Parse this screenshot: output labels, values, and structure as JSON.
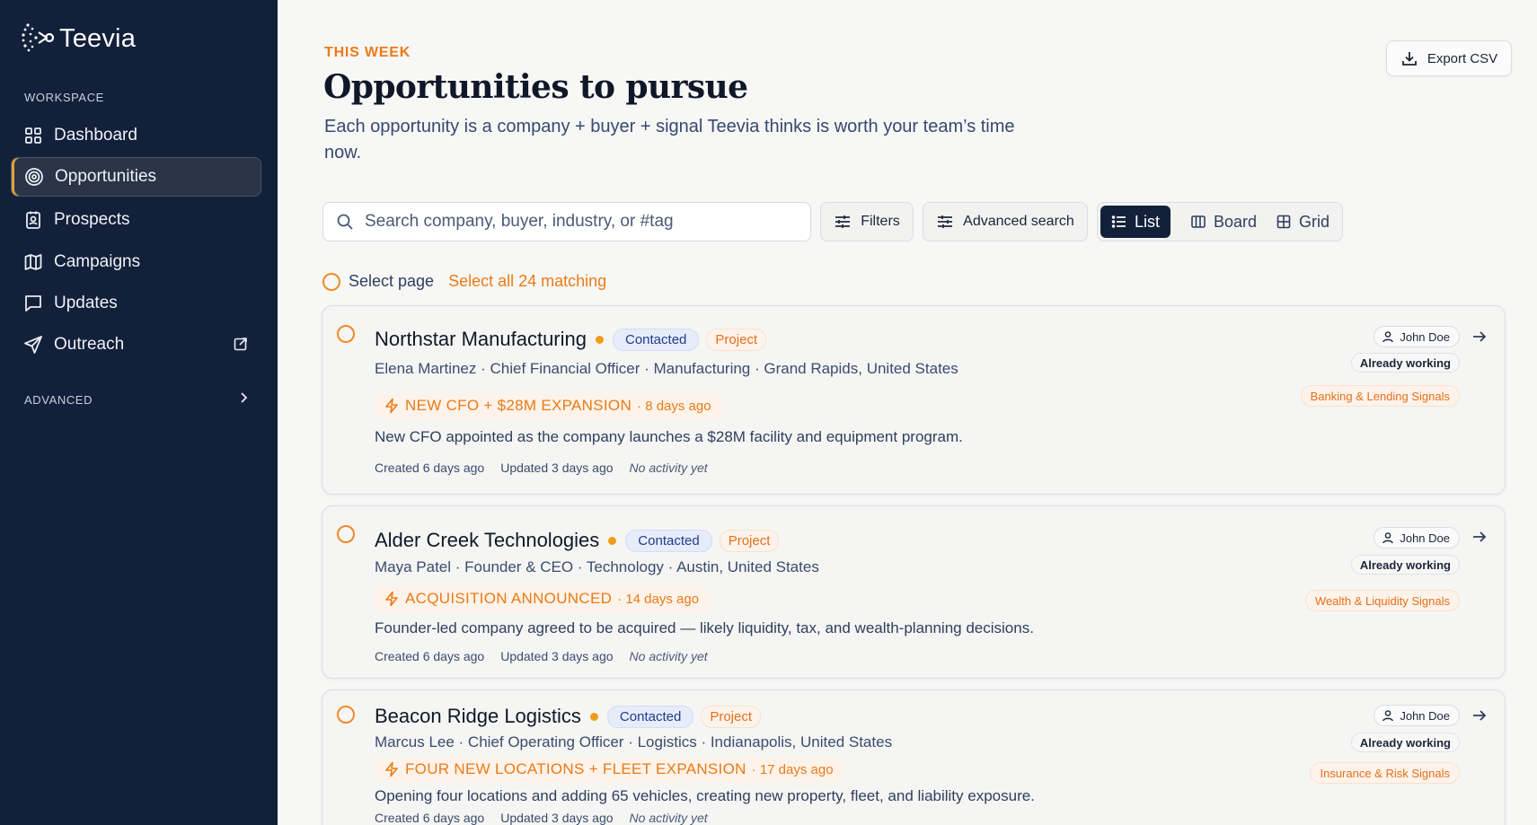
{
  "sidebar": {
    "brand": "Teevia",
    "workspace_label": "WORKSPACE",
    "items": [
      {
        "label": "Dashboard"
      },
      {
        "label": "Opportunities"
      },
      {
        "label": "Prospects"
      },
      {
        "label": "Campaigns"
      },
      {
        "label": "Updates"
      },
      {
        "label": "Outreach"
      }
    ],
    "advanced_label": "ADVANCED"
  },
  "header": {
    "eyebrow": "THIS WEEK",
    "title": "Opportunities to pursue",
    "subtitle": "Each opportunity is a company + buyer + signal Teevia thinks is worth your team’s time now.",
    "export_label": "Export CSV"
  },
  "toolbar": {
    "search_placeholder": "Search company, buyer, industry, or #tag",
    "filters_label": "Filters",
    "advanced_label": "Advanced search",
    "views": [
      "List",
      "Board",
      "Grid"
    ],
    "active_view": "List"
  },
  "selection": {
    "select_page": "Select page",
    "select_all": "Select all 24 matching"
  },
  "opportunities": [
    {
      "company": "Northstar Manufacturing",
      "status": "Contacted",
      "type": "Project",
      "meta": "Elena Martinez · Chief Financial Officer · Manufacturing · Grand Rapids, United States",
      "signal": "NEW CFO + $28M EXPANSION",
      "signal_age": "· 8 days ago",
      "description": "New CFO appointed as the company launches a $28M facility and equipment program.",
      "created": "Created 6 days ago",
      "updated": "Updated 3 days ago",
      "activity": "No activity yet",
      "owner": "John Doe",
      "working": "Already working",
      "tag": "Banking & Lending Signals"
    },
    {
      "company": "Alder Creek Technologies",
      "status": "Contacted",
      "type": "Project",
      "meta": "Maya Patel · Founder & CEO · Technology · Austin, United States",
      "signal": "ACQUISITION ANNOUNCED",
      "signal_age": "· 14 days ago",
      "description": "Founder-led company agreed to be acquired — likely liquidity, tax, and wealth-planning decisions.",
      "created": "Created 6 days ago",
      "updated": "Updated 3 days ago",
      "activity": "No activity yet",
      "owner": "John Doe",
      "working": "Already working",
      "tag": "Wealth & Liquidity Signals"
    },
    {
      "company": "Beacon Ridge Logistics",
      "status": "Contacted",
      "type": "Project",
      "meta": "Marcus Lee · Chief Operating Officer · Logistics · Indianapolis, United States",
      "signal": "FOUR NEW LOCATIONS + FLEET EXPANSION",
      "signal_age": "· 17 days ago",
      "description": "Opening four locations and adding 65 vehicles, creating new property, fleet, and liability exposure.",
      "created": "Created 6 days ago",
      "updated": "Updated 3 days ago",
      "activity": "No activity yet",
      "owner": "John Doe",
      "working": "Already working",
      "tag": "Insurance & Risk Signals"
    }
  ],
  "colors": {
    "sidebar_bg": "#13203a",
    "accent": "#ec7a16",
    "status_blue": "#1f3c8a"
  }
}
